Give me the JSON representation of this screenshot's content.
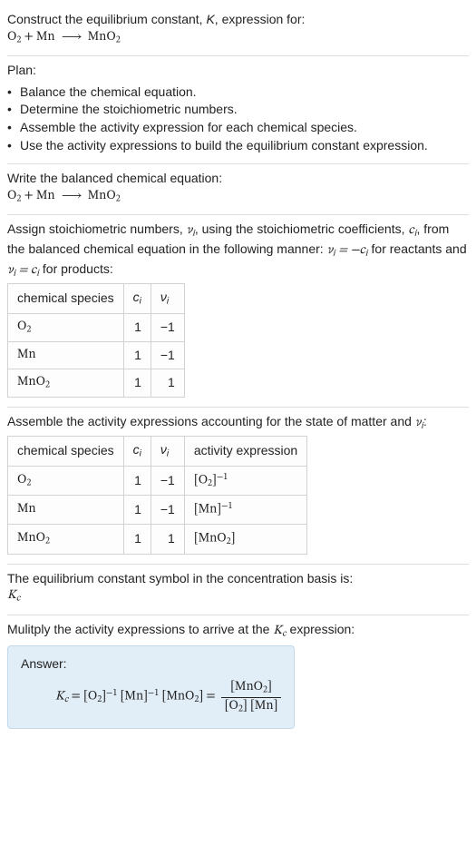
{
  "intro_line1": "Construct the equilibrium constant, ",
  "intro_K": "K",
  "intro_line1_after": ", expression for:",
  "eqn_lhs_O2": "O",
  "eqn_lhs_O2_sub": "2",
  "eqn_plus": " + Mn ",
  "eqn_arrow": "⟶",
  "eqn_rhs": " MnO",
  "eqn_rhs_sub": "2",
  "plan_label": "Plan:",
  "plan_items": [
    "Balance the chemical equation.",
    "Determine the stoichiometric numbers.",
    "Assemble the activity expression for each chemical species.",
    "Use the activity expressions to build the equilibrium constant expression."
  ],
  "balanced_label": "Write the balanced chemical equation:",
  "assign_text_1": "Assign stoichiometric numbers, ",
  "nu_i": "ν",
  "nu_i_sub": "i",
  "assign_text_2": ", using the stoichiometric coefficients, ",
  "c_i": "c",
  "c_i_sub": "i",
  "assign_text_3": ", from the balanced chemical equation in the following manner: ",
  "rule_reactants_lhs": "ν",
  "rule_reactants_eq": " = −",
  "rule_reactants_after": " for reactants and ",
  "rule_products_eq": " = ",
  "rule_products_after": " for products:",
  "table1": {
    "headers": {
      "species": "chemical species",
      "ci": "c",
      "ci_sub": "i",
      "nui": "ν",
      "nui_sub": "i"
    },
    "rows": [
      {
        "species": "O",
        "species_sub": "2",
        "ci": "1",
        "nui": "−1"
      },
      {
        "species": "Mn",
        "species_sub": "",
        "ci": "1",
        "nui": "−1"
      },
      {
        "species": "MnO",
        "species_sub": "2",
        "ci": "1",
        "nui": "1"
      }
    ]
  },
  "assemble_text_1": "Assemble the activity expressions accounting for the state of matter and ",
  "assemble_text_2": ":",
  "table2": {
    "headers": {
      "species": "chemical species",
      "ci": "c",
      "ci_sub": "i",
      "nui": "ν",
      "nui_sub": "i",
      "act": "activity expression"
    },
    "rows": [
      {
        "species": "O",
        "species_sub": "2",
        "ci": "1",
        "nui": "−1",
        "act_pre": "[O",
        "act_sub": "2",
        "act_post": "]",
        "act_sup": "−1"
      },
      {
        "species": "Mn",
        "species_sub": "",
        "ci": "1",
        "nui": "−1",
        "act_pre": "[Mn]",
        "act_sub": "",
        "act_post": "",
        "act_sup": "−1"
      },
      {
        "species": "MnO",
        "species_sub": "2",
        "ci": "1",
        "nui": "1",
        "act_pre": "[MnO",
        "act_sub": "2",
        "act_post": "]",
        "act_sup": ""
      }
    ]
  },
  "symbol_text": "The equilibrium constant symbol in the concentration basis is:",
  "Kc": "K",
  "Kc_sub": "c",
  "multiply_text_1": "Mulitply the activity expressions to arrive at the ",
  "multiply_text_2": " expression:",
  "answer_label": "Answer:",
  "final_lhs": "K",
  "final_eq": " = [O",
  "final_O2_sub": "2",
  "final_O2_sup": "−1",
  "final_Mn": " [Mn]",
  "final_Mn_sup": "−1",
  "final_MnO2": " [MnO",
  "final_MnO2_sub": "2",
  "final_MnO2_post": "] = ",
  "frac_num_pre": "[MnO",
  "frac_num_sub": "2",
  "frac_num_post": "]",
  "frac_den_pre": "[O",
  "frac_den_O2_sub": "2",
  "frac_den_mid": "] [Mn]",
  "chart_data": {
    "type": "table",
    "tables": [
      {
        "columns": [
          "chemical species",
          "c_i",
          "ν_i"
        ],
        "rows": [
          [
            "O2",
            1,
            -1
          ],
          [
            "Mn",
            1,
            -1
          ],
          [
            "MnO2",
            1,
            1
          ]
        ]
      },
      {
        "columns": [
          "chemical species",
          "c_i",
          "ν_i",
          "activity expression"
        ],
        "rows": [
          [
            "O2",
            1,
            -1,
            "[O2]^-1"
          ],
          [
            "Mn",
            1,
            -1,
            "[Mn]^-1"
          ],
          [
            "MnO2",
            1,
            1,
            "[MnO2]"
          ]
        ]
      }
    ]
  }
}
